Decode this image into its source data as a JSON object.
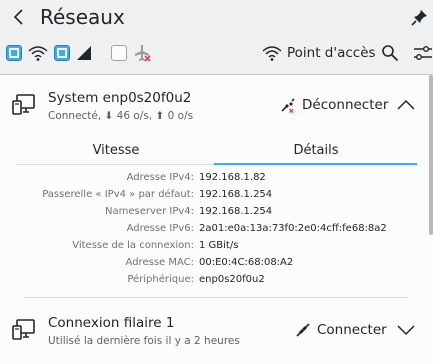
{
  "header": {
    "title": "Réseaux"
  },
  "toolbar": {
    "wifi_enabled": true,
    "mobile_enabled": true,
    "airplane_mode": false,
    "hotspot_label": "Point d'accès"
  },
  "connections": [
    {
      "name": "System enp0s20f0u2",
      "status": "Connecté, ⬇ 46 o/s, ⬆ 0 o/s",
      "action_label": "Déconnecter",
      "expanded": true
    },
    {
      "name": "Connexion filaire 1",
      "status": "Utilisé la dernière fois il y a 2 heures",
      "action_label": "Connecter",
      "expanded": false
    }
  ],
  "tabs": [
    {
      "label": "Vitesse",
      "active": false
    },
    {
      "label": "Détails",
      "active": true
    }
  ],
  "details": [
    {
      "label": "Adresse IPv4:",
      "value": "192.168.1.82"
    },
    {
      "label": "Passerelle « IPv4 » par défaut:",
      "value": "192.168.1.254"
    },
    {
      "label": "Nameserver IPv4:",
      "value": "192.168.1.254"
    },
    {
      "label": "Adresse IPv6:",
      "value": "2a01:e0a:13a:73f0:2e0:4cff:fe68:8a2"
    },
    {
      "label": "Vitesse de la connexion:",
      "value": "1 GBit/s"
    },
    {
      "label": "Adresse MAC:",
      "value": "00:E0:4C:68:08:A2"
    },
    {
      "label": "Périphérique:",
      "value": "enp0s20f0u2"
    }
  ],
  "colors": {
    "accent": "#3daee9",
    "text": "#232629",
    "muted": "#6f7275",
    "background": "#eff0f1",
    "view": "#fcfcfc",
    "error": "#da4453"
  }
}
